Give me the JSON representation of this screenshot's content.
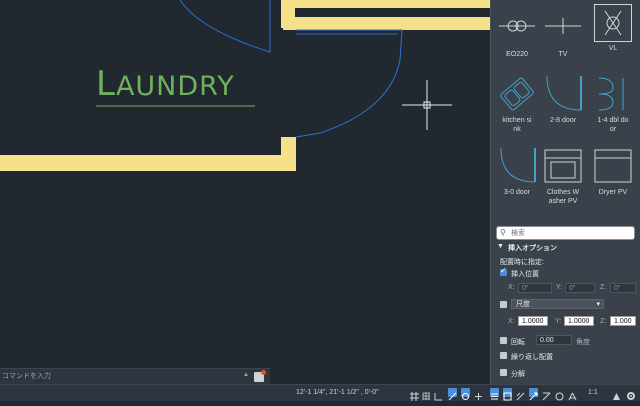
{
  "canvas": {
    "room_label": "LAUNDRY",
    "room_label_first": "L",
    "room_label_rest": "AUNDRY"
  },
  "command_line": {
    "placeholder": "コマンドを入力"
  },
  "blocks": [
    {
      "name": "EO220",
      "icon": "outlet-symbol-icon"
    },
    {
      "name": "TV",
      "icon": "tv-symbol-icon"
    },
    {
      "name": "VL",
      "icon": "vl-symbol-icon"
    },
    {
      "name": "kitchen sink",
      "label_display": "kitchen si\nnk",
      "icon": "kitchen-sink-icon"
    },
    {
      "name": "2-8 door",
      "icon": "door-swing-icon"
    },
    {
      "name": "1-4 dbl door",
      "label_display": "1-4 dbl do\nor",
      "icon": "double-door-icon"
    },
    {
      "name": "3-0 door",
      "icon": "door-3-0-icon"
    },
    {
      "name": "Clothes Washer PV",
      "label_display": "Clothes W\nasher PV",
      "icon": "washer-icon"
    },
    {
      "name": "Dryer PV",
      "icon": "dryer-icon"
    }
  ],
  "search": {
    "placeholder": "検索"
  },
  "insert_options": {
    "header": "挿入オプション",
    "specify_on_place": "配置時に指定:",
    "insertion_point": {
      "label": "挿入位置",
      "checked": true,
      "x_label": "X:",
      "x": "0\"",
      "y_label": "Y:",
      "y": "0\"",
      "z_label": "Z:",
      "z": "0\""
    },
    "scale": {
      "checked": false,
      "option": "尺度",
      "x_label": "X:",
      "x": "1.0000",
      "y_label": "Y:",
      "y": "1.0000",
      "z_label": "Z:",
      "z": "1.000"
    },
    "rotation": {
      "label": "回転",
      "value": "0.00",
      "unit": "角度",
      "checked": false
    },
    "repeat_place": {
      "label": "繰り返し配置",
      "checked": false
    },
    "explode": {
      "label": "分解",
      "checked": false
    }
  },
  "status_bar": {
    "coordinates": "12'-1 1/4\",  21'-1 1/2\" , 0'-0\"",
    "scale": "1:1"
  },
  "colors": {
    "wall_fill": "#f5e18a",
    "door_blue": "#2f6fd0",
    "label_green": "#6fb25c",
    "background": "#212830"
  }
}
